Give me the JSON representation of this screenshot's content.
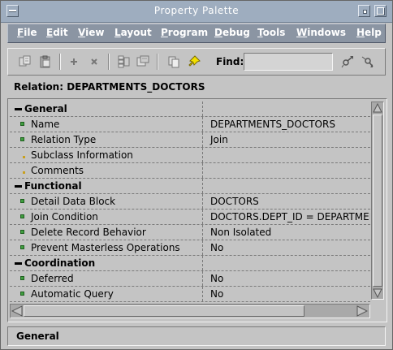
{
  "window": {
    "title": "Property Palette"
  },
  "menu": [
    {
      "label": "File",
      "mnemonic": "F",
      "rest": "ile"
    },
    {
      "label": "Edit",
      "mnemonic": "E",
      "rest": "dit"
    },
    {
      "label": "View",
      "mnemonic": "V",
      "rest": "iew"
    },
    {
      "label": "Layout",
      "mnemonic": "L",
      "rest": "ayout"
    },
    {
      "label": "Program",
      "mnemonic": "P",
      "rest": "rogram"
    },
    {
      "label": "Debug",
      "mnemonic": "D",
      "rest": "ebug"
    },
    {
      "label": "Tools",
      "mnemonic": "T",
      "rest": "ools"
    },
    {
      "label": "Windows",
      "mnemonic": "W",
      "rest": "indows"
    },
    {
      "label": "Help",
      "mnemonic": "H",
      "rest": "elp"
    }
  ],
  "toolbar": {
    "icons": [
      "copy-properties-icon",
      "paste-properties-icon",
      "add-property-icon",
      "delete-property-icon",
      "union-icon",
      "intersection-icon",
      "inherit-icon",
      "freeze-pin-icon",
      "find-next-icon",
      "find-previous-icon"
    ],
    "find_label": "Find:",
    "find_value": ""
  },
  "relation_label": "Relation: DEPARTMENTS_DOCTORS",
  "properties": [
    {
      "kind": "category",
      "label": "General",
      "value": ""
    },
    {
      "kind": "property",
      "marker": "square",
      "label": "Name",
      "value": "DEPARTMENTS_DOCTORS"
    },
    {
      "kind": "property",
      "marker": "square",
      "label": "Relation Type",
      "value": "Join"
    },
    {
      "kind": "property",
      "marker": "dot",
      "label": "Subclass Information",
      "value": ""
    },
    {
      "kind": "property",
      "marker": "dot",
      "label": "Comments",
      "value": ""
    },
    {
      "kind": "category",
      "label": "Functional",
      "value": ""
    },
    {
      "kind": "property",
      "marker": "square",
      "label": "Detail Data Block",
      "value": "DOCTORS"
    },
    {
      "kind": "property",
      "marker": "square",
      "label": "Join Condition",
      "value": "DOCTORS.DEPT_ID = DEPARTMENTS.DEPT_ID"
    },
    {
      "kind": "property",
      "marker": "square",
      "label": "Delete Record Behavior",
      "value": "Non Isolated"
    },
    {
      "kind": "property",
      "marker": "square",
      "label": "Prevent Masterless Operations",
      "value": "No"
    },
    {
      "kind": "category",
      "label": "Coordination",
      "value": ""
    },
    {
      "kind": "property",
      "marker": "square",
      "label": "Deferred",
      "value": "No"
    },
    {
      "kind": "property",
      "marker": "square",
      "label": "Automatic Query",
      "value": "No"
    }
  ],
  "status": "General",
  "colors": {
    "titlebar": "#9eadbf",
    "menubar": "#8b95a3",
    "window": "#c4c4c4",
    "marker": "#3f9e3f"
  }
}
